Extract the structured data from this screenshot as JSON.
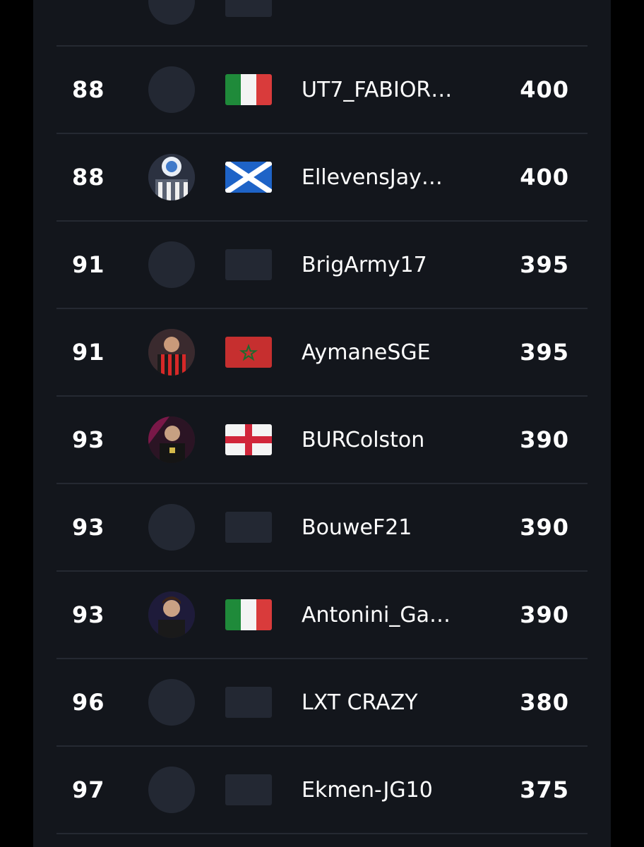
{
  "leaderboard": {
    "rows": [
      {
        "rank": "88",
        "avatar": "avatar-placeholder",
        "flag": "italy-flag",
        "name": "UT7_FABIOR…",
        "points": "400"
      },
      {
        "rank": "88",
        "avatar": "player-avatar-photo",
        "flag": "scotland-flag",
        "name": "EllevensJay…",
        "points": "400"
      },
      {
        "rank": "91",
        "avatar": "avatar-placeholder",
        "flag": "flag-placeholder",
        "name": "BrigArmy17",
        "points": "395"
      },
      {
        "rank": "91",
        "avatar": "player-avatar-photo",
        "flag": "morocco-flag",
        "name": "AymaneSGE",
        "points": "395"
      },
      {
        "rank": "93",
        "avatar": "player-avatar-photo",
        "flag": "england-flag",
        "name": "BURColston",
        "points": "390"
      },
      {
        "rank": "93",
        "avatar": "avatar-placeholder",
        "flag": "flag-placeholder",
        "name": "BouweF21",
        "points": "390"
      },
      {
        "rank": "93",
        "avatar": "player-avatar-photo",
        "flag": "italy-flag",
        "name": "Antonini_Ga…",
        "points": "390"
      },
      {
        "rank": "96",
        "avatar": "avatar-placeholder",
        "flag": "flag-placeholder",
        "name": "LXT CRAZY",
        "points": "380"
      },
      {
        "rank": "97",
        "avatar": "avatar-placeholder",
        "flag": "flag-placeholder",
        "name": "Ekmen-JG10",
        "points": "375"
      }
    ]
  },
  "colors": {
    "background": "#000000",
    "panel": "#13161c",
    "row_divider": "#252932",
    "placeholder": "#232833",
    "text": "#ffffff",
    "italy_green": "#1f8a3a",
    "italy_red": "#d93b3b",
    "scotland_blue": "#1e63c7",
    "morocco_red": "#c62f2f",
    "england_red": "#d1263a"
  }
}
